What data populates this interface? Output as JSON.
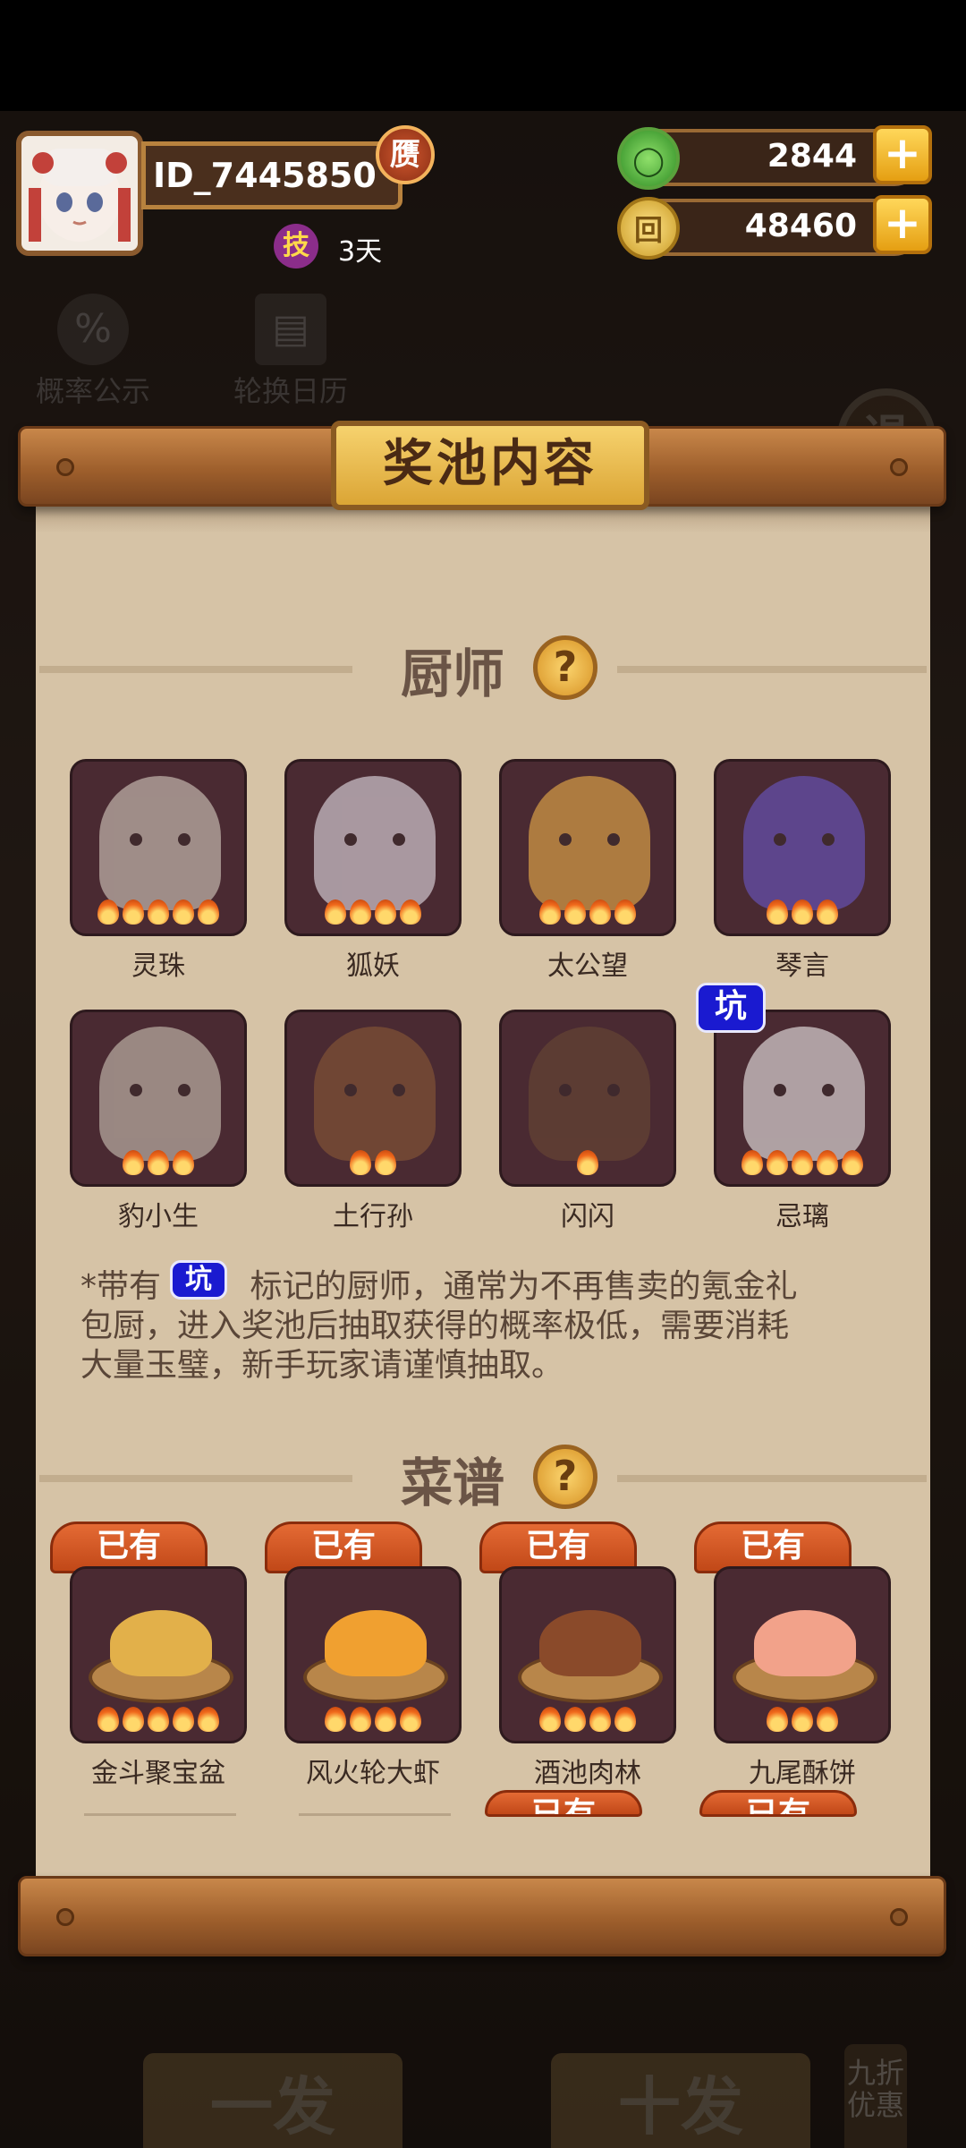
{
  "player": {
    "id": "ID_7445850",
    "badge": "赝",
    "skill_icon": "技",
    "skill_days": "3天"
  },
  "resources": [
    {
      "name": "jade",
      "value": "2844",
      "icon": "jade-coin-icon"
    },
    {
      "name": "gold",
      "value": "48460",
      "icon": "gold-coin-icon"
    }
  ],
  "background": {
    "prob_label": "概率公示",
    "calendar_label": "轮换日历",
    "retreat_label": "退",
    "single_draw": "一发",
    "ten_draw": "十发",
    "discount": "九折优惠"
  },
  "modal": {
    "title": "奖池内容",
    "chef_section": "厨师",
    "recipe_section": "菜谱",
    "pit_label": "坑",
    "owned_label": "已有",
    "note_prefix": "*带有",
    "note_line1": " 标记的厨师，通常为不再售卖的氪金礼",
    "note_line2": "包厨，进入奖池后抽取获得的概率极低，需要消耗",
    "note_line3": "大量玉璧，新手玩家请谨慎抽取。",
    "chefs": [
      {
        "name": "灵珠",
        "stars": 5,
        "pit": false,
        "color": "#d8cfc2"
      },
      {
        "name": "狐妖",
        "stars": 4,
        "pit": false,
        "color": "#e8e2ea"
      },
      {
        "name": "太公望",
        "stars": 4,
        "pit": false,
        "color": "#f0b24a"
      },
      {
        "name": "琴言",
        "stars": 3,
        "pit": false,
        "color": "#6a58c8"
      },
      {
        "name": "豹小生",
        "stars": 3,
        "pit": false,
        "color": "#cfc7b8"
      },
      {
        "name": "土行孙",
        "stars": 2,
        "pit": false,
        "color": "#8a5a36"
      },
      {
        "name": "闪闪",
        "stars": 1,
        "pit": false,
        "color": "#6a4a34"
      },
      {
        "name": "忌璃",
        "stars": 5,
        "pit": true,
        "color": "#f4f1ee"
      }
    ],
    "recipes": [
      {
        "name": "金斗聚宝盆",
        "stars": 5,
        "owned": true,
        "color": "#e2b04a"
      },
      {
        "name": "风火轮大虾",
        "stars": 4,
        "owned": true,
        "color": "#f0a030"
      },
      {
        "name": "酒池肉林",
        "stars": 4,
        "owned": true,
        "color": "#8a4a2a"
      },
      {
        "name": "九尾酥饼",
        "stars": 3,
        "owned": true,
        "color": "#f2a28a"
      }
    ]
  }
}
